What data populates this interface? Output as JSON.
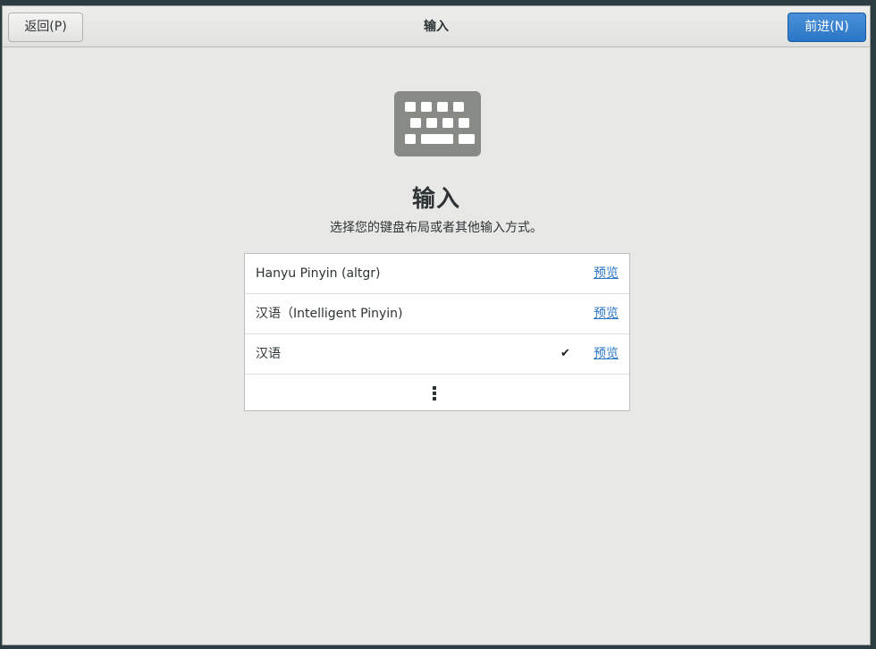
{
  "header": {
    "back_label": "返回(P)",
    "title": "输入",
    "next_label": "前进(N)"
  },
  "main": {
    "icon": "keyboard-icon",
    "title": "输入",
    "subtitle": "选择您的键盘布局或者其他输入方式。"
  },
  "input_sources": [
    {
      "label": "Hanyu Pinyin (altgr)",
      "selected": false,
      "preview_label": "预览"
    },
    {
      "label": "汉语（Intelligent Pinyin)",
      "selected": false,
      "preview_label": "预览"
    },
    {
      "label": "汉语",
      "selected": true,
      "preview_label": "预览"
    }
  ],
  "check_mark": "✔",
  "more_icon": "more-vertical-icon",
  "colors": {
    "accent": "#2a76c6",
    "background": "#e8e8e7",
    "icon_gray": "#888a85"
  }
}
